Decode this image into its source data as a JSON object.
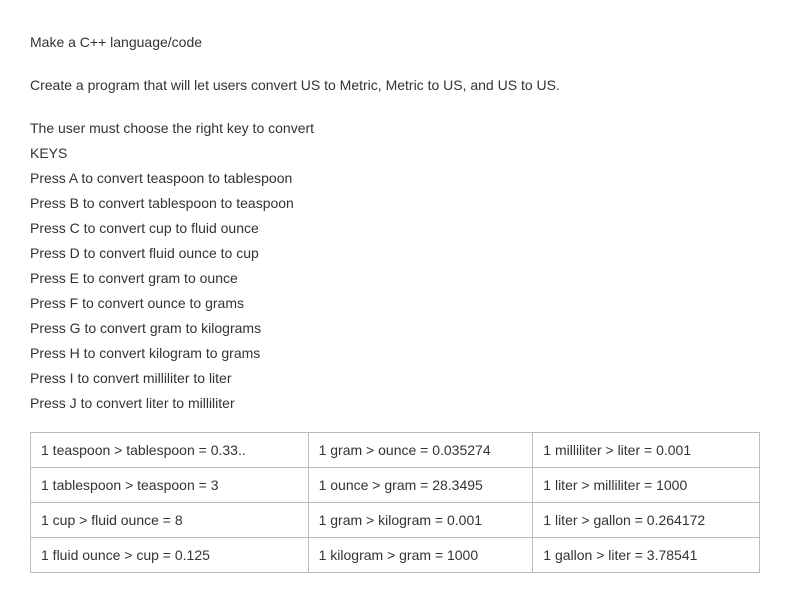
{
  "title": "Make a C++ language/code",
  "intro": "Create a program that will let users convert US to Metric, Metric to US, and US to US.",
  "instruction": "The user must choose the right key to convert",
  "keys_heading": "KEYS",
  "keys": [
    "Press A to convert teaspoon to tablespoon",
    "Press B to convert tablespoon to teaspoon",
    "Press C to convert cup to fluid ounce",
    "Press D to convert fluid ounce to cup",
    "Press E to convert gram to ounce",
    "Press F to convert ounce to grams",
    "Press G to convert gram to kilograms",
    "Press H to convert kilogram to grams",
    "Press I to convert  milliliter to liter",
    "Press J to convert liter to milliliter"
  ],
  "table": [
    [
      "1 teaspoon > tablespoon =  0.33..",
      "1 gram > ounce = 0.035274",
      "1 milliliter > liter = 0.001"
    ],
    [
      "1 tablespoon > teaspoon = 3",
      "1 ounce > gram = 28.3495",
      "1 liter > milliliter = 1000"
    ],
    [
      "1 cup > fluid ounce = 8",
      "1 gram > kilogram = 0.001",
      "1 liter > gallon = 0.264172"
    ],
    [
      "1 fluid ounce > cup = 0.125",
      "1 kilogram > gram = 1000",
      "1 gallon > liter = 3.78541"
    ]
  ]
}
